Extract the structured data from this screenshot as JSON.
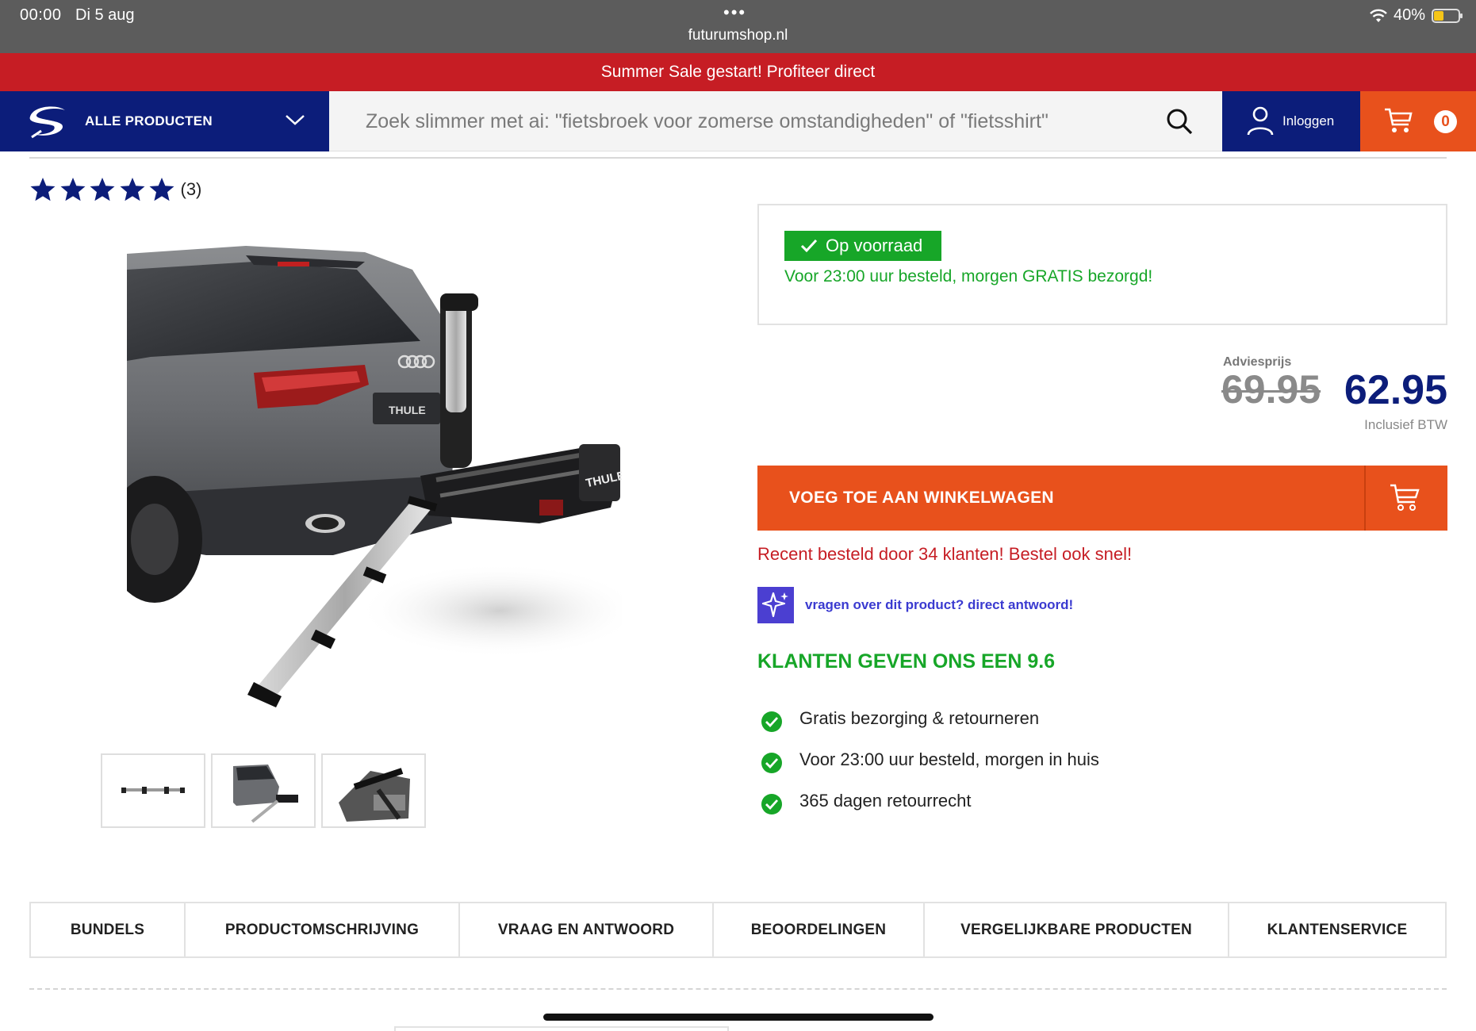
{
  "status_bar": {
    "time": "00:00",
    "date": "Di 5 aug",
    "url": "futurumshop.nl",
    "battery": "40%",
    "battery_level": 0.4
  },
  "promo": {
    "text": "Summer Sale gestart! Profiteer direct"
  },
  "header": {
    "category_label": "ALLE PRODUCTEN",
    "search_placeholder": "Zoek slimmer met ai: \"fietsbroek voor zomerse omstandigheden\" of \"fietsshirt\"",
    "login_label": "Inloggen",
    "cart_count": "0"
  },
  "rating": {
    "stars": 5,
    "count": "(3)"
  },
  "stock": {
    "badge": "Op voorraad",
    "note": "Voor 23:00 uur besteld, morgen GRATIS bezorgd!"
  },
  "price": {
    "advies_label": "Adviesprijs",
    "old": "69.95",
    "new": "62.95",
    "vat_note": "Inclusief BTW"
  },
  "add_to_cart": {
    "label": "VOEG TOE AAN WINKELWAGEN"
  },
  "recent_orders": "Recent besteld door 34 klanten! Bestel ook snel!",
  "ai_question": "vragen over dit product? direct antwoord!",
  "customer_score": "KLANTEN GEVEN ONS EEN 9.6",
  "usps": [
    "Gratis bezorging & retourneren",
    "Voor 23:00 uur besteld, morgen in huis",
    "365 dagen retourrecht"
  ],
  "tabs": [
    "BUNDELS",
    "PRODUCTOMSCHRIJVING",
    "VRAAG EN ANTWOORD",
    "BEOORDELINGEN",
    "VERGELIJKBARE PRODUCTEN",
    "KLANTENSERVICE"
  ],
  "colors": {
    "navy": "#0c1d7a",
    "orange": "#e8511c",
    "red": "#c61d24",
    "green": "#17a628",
    "ai_purple": "#4b3fd1"
  },
  "icons": [
    "wifi-icon",
    "battery-icon",
    "logo-icon",
    "chevron-down-icon",
    "search-icon",
    "user-icon",
    "cart-icon",
    "star-icon",
    "check-icon",
    "sparkle-icon",
    "check-circle-icon"
  ]
}
